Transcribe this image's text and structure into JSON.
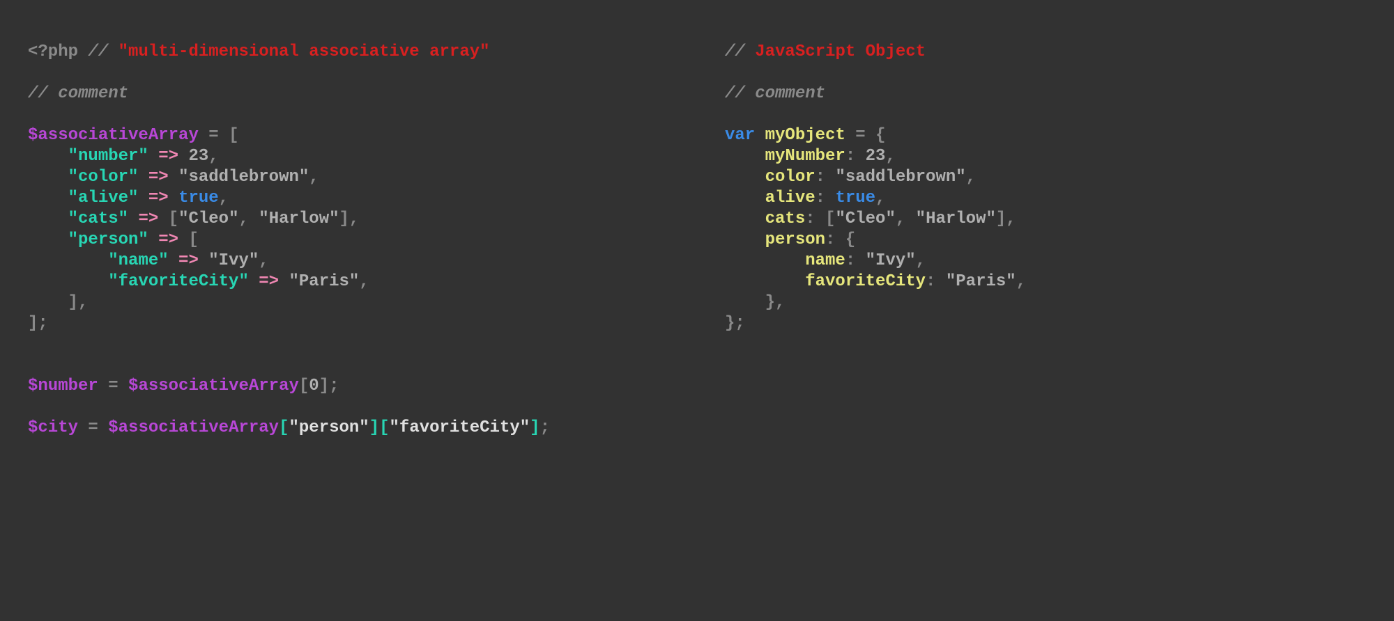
{
  "php": {
    "open_tag": "<?php",
    "slashes": "//",
    "title": "\"multi-dimensional associative array\"",
    "comment": "comment",
    "var_array": "$associativeArray",
    "eq": "=",
    "lbrack": "[",
    "rbrack": "]",
    "semi": ";",
    "comma": ",",
    "arrow": "=>",
    "k_number": "\"number\"",
    "v_number": "23",
    "k_color": "\"color\"",
    "v_color": "\"saddlebrown\"",
    "k_alive": "\"alive\"",
    "v_alive": "true",
    "k_cats": "\"cats\"",
    "v_cats_open": "[",
    "v_cat1": "\"Cleo\"",
    "v_cat2": "\"Harlow\"",
    "v_cats_close": "]",
    "k_person": "\"person\"",
    "k_name": "\"name\"",
    "v_name": "\"Ivy\"",
    "k_favcity": "\"favoriteCity\"",
    "v_favcity": "\"Paris\"",
    "close_bracket_semi": "];",
    "var_number": "$number",
    "idx0": "0",
    "var_city": "$city",
    "idx_person": "\"person\"",
    "idx_favcity": "\"favoriteCity\""
  },
  "js": {
    "slashes": "//",
    "title": "JavaScript Object",
    "comment": "comment",
    "kw_var": "var",
    "obj_name": "myObject",
    "eq": "=",
    "lbrace": "{",
    "rbrace": "}",
    "colon": ":",
    "semi": ";",
    "comma": ",",
    "k_mynumber": "myNumber",
    "v_number": "23",
    "k_color": "color",
    "v_color": "\"saddlebrown\"",
    "k_alive": "alive",
    "v_alive": "true",
    "k_cats": "cats",
    "lbrack": "[",
    "v_cat1": "\"Cleo\"",
    "v_cat2": "\"Harlow\"",
    "rbrack": "]",
    "k_person": "person",
    "k_name": "name",
    "v_name": "\"Ivy\"",
    "k_favcity": "favoriteCity",
    "v_favcity": "\"Paris\"",
    "close_brace_semi": "};"
  }
}
